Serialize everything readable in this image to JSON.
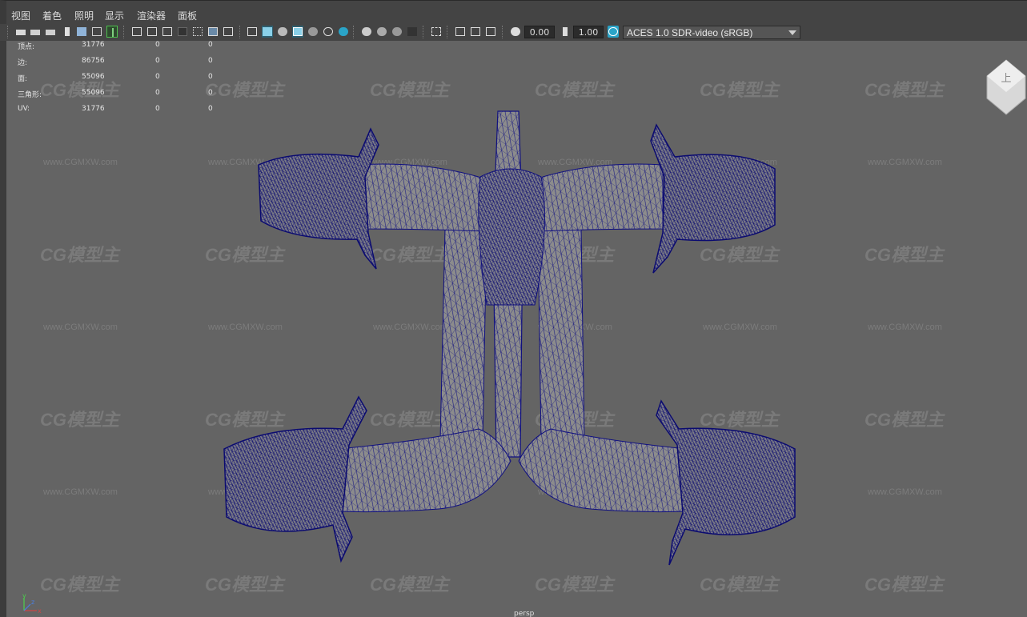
{
  "menu": [
    "视图",
    "着色",
    "照明",
    "显示",
    "渲染器",
    "面板"
  ],
  "toolbar": {
    "exposure": "0.00",
    "gamma": "1.00",
    "color_management_label": "ACES 1.0 SDR-video (sRGB)",
    "icons": [
      "camera-icon",
      "lock-camera-icon",
      "camera-attributes-icon",
      "bookmark-icon",
      "image-plane-icon",
      "2d-pan-zoom-icon",
      "grease-pencil-icon",
      "grid-icon",
      "film-gate-icon",
      "resolution-gate-icon",
      "gate-mask-icon",
      "field-chart-icon",
      "safe-action-icon",
      "safe-title-icon",
      "wireframe-icon",
      "smooth-shade-icon",
      "default-material-icon",
      "wireframe-on-shaded-icon",
      "xray-icon",
      "use-default-light-icon",
      "shadows-icon",
      "screen-space-ao-icon",
      "motion-blur-icon",
      "multisample-aa-icon",
      "depth-of-field-icon",
      "isolate-select-icon",
      "xray-joints-icon",
      "textured-icon",
      "backface-icon",
      "color-management-icon"
    ]
  },
  "stats": {
    "rows": [
      {
        "label": "顶点:",
        "values": [
          "31776",
          "0",
          "0"
        ]
      },
      {
        "label": "边:",
        "values": [
          "86756",
          "0",
          "0"
        ]
      },
      {
        "label": "面:",
        "values": [
          "55096",
          "0",
          "0"
        ]
      },
      {
        "label": "三角形:",
        "values": [
          "55096",
          "0",
          "0"
        ]
      },
      {
        "label": "UV:",
        "values": [
          "31776",
          "0",
          "0"
        ]
      }
    ]
  },
  "viewport": {
    "camera": "persp",
    "viewcube_label": "上",
    "axis": {
      "y": "y",
      "z": "z",
      "x": "x"
    }
  },
  "watermark": {
    "logo": "CG模型主",
    "url": "www.CGMXW.com"
  },
  "colors": {
    "background": "#646464",
    "wireframe": "#0f0f7a",
    "mesh_fill": "#8a8a8a",
    "accent": "#2aa4c8"
  }
}
